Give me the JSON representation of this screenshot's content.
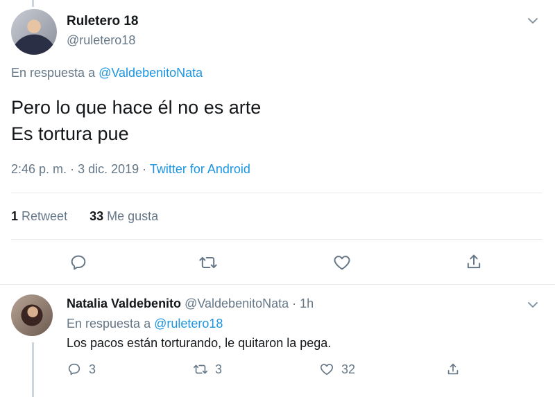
{
  "tweet": {
    "name": "Ruletero 18",
    "handle": "@ruletero18",
    "reply_prefix": "En respuesta a",
    "reply_handle": "@ValdebenitoNata",
    "text_line1": "Pero lo que hace él no es arte",
    "text_line2": "Es tortura pue",
    "time": "2:46 p. m.",
    "sep1": "·",
    "date": "3 dic. 2019",
    "sep2": "·",
    "source": "Twitter for Android",
    "retweets_count": "1",
    "retweets_label": "Retweet",
    "likes_count": "33",
    "likes_label": "Me gusta"
  },
  "reply": {
    "name": "Natalia Valdebenito",
    "handle": "@ValdebenitoNata",
    "sep": "·",
    "age": "1h",
    "reply_prefix": "En respuesta a",
    "reply_handle": "@ruletero18",
    "text": "Los pacos están torturando, le quitaron la pega.",
    "replies": "3",
    "retweets": "3",
    "likes": "32"
  },
  "icons": {
    "reply": "reply-icon",
    "retweet": "retweet-icon",
    "like": "heart-icon",
    "share": "share-icon",
    "chevron": "chevron-down-icon"
  },
  "colors": {
    "link": "#1b95e0",
    "muted": "#657786",
    "text": "#14171a",
    "divider": "#e6ecf0"
  }
}
